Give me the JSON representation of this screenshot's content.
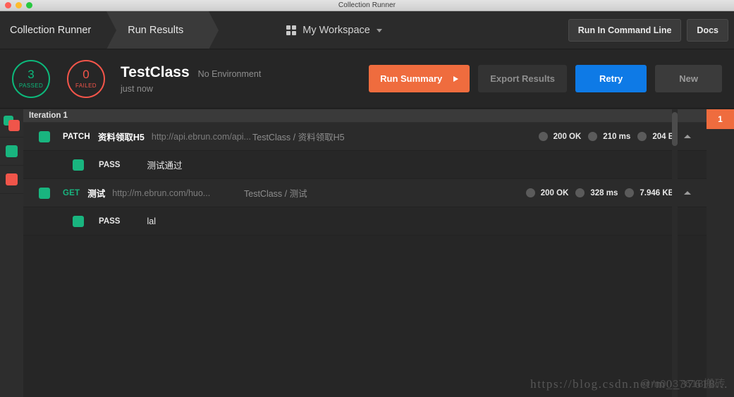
{
  "window": {
    "title": "Collection Runner",
    "traffic_lights": [
      "close-red",
      "minimize-yellow",
      "maximize-green"
    ]
  },
  "topbar": {
    "breadcrumbs": [
      {
        "label": "Collection Runner",
        "active": false
      },
      {
        "label": "Run Results",
        "active": true
      }
    ],
    "workspace": {
      "icon": "grid-icon",
      "label": "My Workspace",
      "caret": "chevron-down-icon"
    },
    "actions": [
      {
        "label": "Run In Command Line"
      },
      {
        "label": "Docs"
      }
    ]
  },
  "summary": {
    "passed": {
      "count": "3",
      "label": "PASSED",
      "color": "#0cb97b"
    },
    "failed": {
      "count": "0",
      "label": "FAILED",
      "color": "#f4554a"
    },
    "run_name": "TestClass",
    "environment": "No Environment",
    "timestamp": "just now",
    "buttons": {
      "run_summary": "Run Summary",
      "export_results": "Export Results",
      "retry": "Retry",
      "new": "New"
    },
    "accent_orange": "#ef6c3e",
    "accent_blue": "#0e7ae6"
  },
  "rail": {
    "items": [
      {
        "icon": "collection-icon"
      },
      {
        "icon": "green-square-icon"
      },
      {
        "icon": "red-square-icon"
      }
    ]
  },
  "results": {
    "iteration_header": "Iteration 1",
    "rows": [
      {
        "type": "request",
        "method": "PATCH",
        "method_class": "patch",
        "name": "资料领取H5",
        "url": "http://api.ebrun.com/api...",
        "path": "TestClass / 资料领取H5",
        "status": "200 OK",
        "time": "210 ms",
        "size": "204 B"
      },
      {
        "type": "test",
        "status": "PASS",
        "name": "测试通过"
      },
      {
        "type": "request",
        "method": "GET",
        "method_class": "get",
        "name": "测试",
        "url": "http://m.ebrun.com/huo...",
        "path": "TestClass / 测试",
        "status": "200 OK",
        "time": "328 ms",
        "size": "7.946 KB"
      },
      {
        "type": "test",
        "status": "PASS",
        "name": "lal"
      }
    ]
  },
  "iteration_tabs": [
    {
      "label": "1",
      "active": true
    }
  ],
  "watermark": {
    "url": "https://blog.csdn.net/m0_37618...",
    "overlay": "@m0_37618搬砖"
  }
}
